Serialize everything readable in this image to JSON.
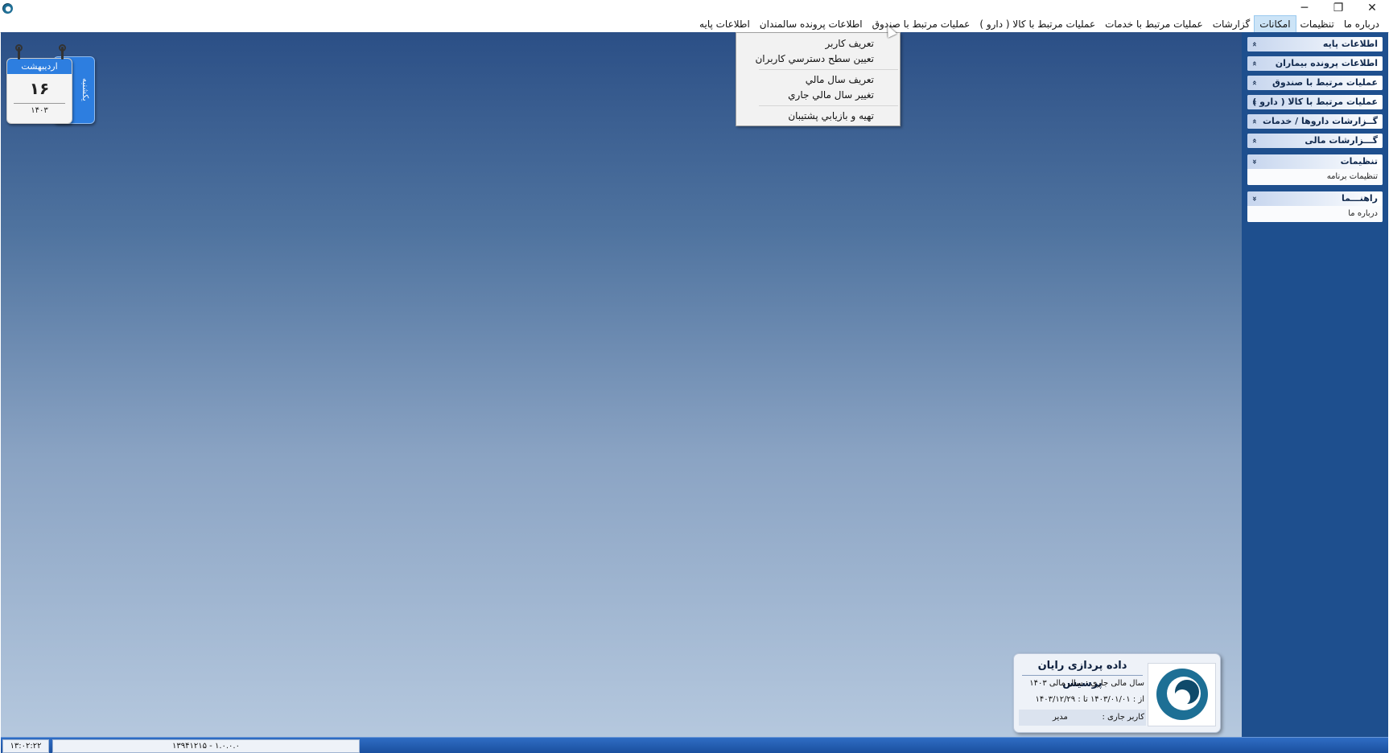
{
  "window": {
    "minimize_glyph": "─",
    "restore_glyph": "❐",
    "close_glyph": "✕"
  },
  "menubar": {
    "items": [
      {
        "label": "اطلاعات پایه"
      },
      {
        "label": "اطلاعات پرونده سالمندان"
      },
      {
        "label": "عملیات مرتبط با صندوق"
      },
      {
        "label": "عملیات مرتبط با کالا ( دارو )"
      },
      {
        "label": "عملیات مرتبط با خدمات"
      },
      {
        "label": "گزارشات"
      },
      {
        "label": "امکانات",
        "active": true
      },
      {
        "label": "تنظیمات"
      },
      {
        "label": "درباره ما"
      }
    ]
  },
  "dropdown": {
    "items": [
      "تعریف کاربر",
      "تعیین سطح دسترسي کاربران",
      "تعریف سال مالي",
      "تغییر سال مالي جاري",
      "تهیه و بازیابي پشتیبان"
    ]
  },
  "sidepanel": {
    "groups": [
      {
        "title": "اطلاعات پایه",
        "chevron": "»",
        "expanded": false,
        "items": []
      },
      {
        "title": "اطلاعات پرونده بیماران",
        "chevron": "»",
        "expanded": false,
        "items": []
      },
      {
        "title": "عملیات مرتبط با صندوق",
        "chevron": "»",
        "expanded": false,
        "items": []
      },
      {
        "title": "عملیات مرتبط با کالا ( دارو )",
        "chevron": "»",
        "expanded": false,
        "items": []
      },
      {
        "title": "گــزارشات داروها / خدمات",
        "chevron": "»",
        "expanded": false,
        "items": []
      },
      {
        "title": "گـــزارشات مالی",
        "chevron": "»",
        "expanded": false,
        "items": []
      },
      {
        "title": "تنظیمات",
        "chevron": "«",
        "expanded": true,
        "items": [
          "تنظیمات برنامه"
        ]
      },
      {
        "title": "راهنـــما",
        "chevron": "«",
        "expanded": true,
        "items": [
          "درباره ما"
        ]
      }
    ]
  },
  "calendar": {
    "month": "اردیبهشت",
    "day_number": "۱۶",
    "year": "۱۴۰۳",
    "weekday": "یکشنبه"
  },
  "company": {
    "name": "داده پردازی رایان پرسیس",
    "fiscal_label": "سال مالی جاری  :   سال مالی ۱۴۰۳",
    "range_label": "از : ۱۴۰۳/۰۱/۰۱   تا : ۱۴۰۳/۱۲/۲۹",
    "user_label": "کاربر جاری :",
    "user_value": "مدیر"
  },
  "statusbar": {
    "time": "۱۳:۰۲:۲۲",
    "version": "۱۳۹۴۱۲۱۵ - ۱.۰.۰.۰"
  },
  "colors": {
    "accent": "#2d7ee0",
    "side_panel": "#1e4f8e",
    "desktop_top": "#2b4f86",
    "desktop_bottom": "#b5c8de"
  }
}
